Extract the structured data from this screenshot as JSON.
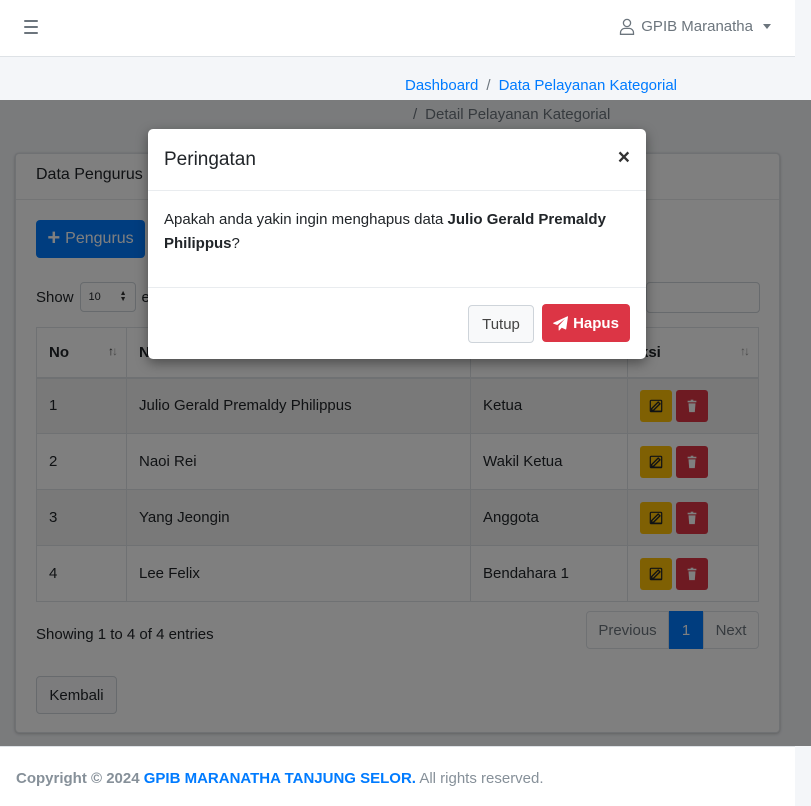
{
  "navbar": {
    "user_name": "GPIB Maranatha"
  },
  "breadcrumb": {
    "items": [
      "Dashboard",
      "Data Pelayanan Kategorial",
      "Detail Pelayanan Kategorial"
    ],
    "separator": "/"
  },
  "card": {
    "title": "Data Pengurus ",
    "add_button_label": "Pengurus",
    "show_label": "Show",
    "length_value": "10",
    "entries_label": "en",
    "columns": [
      "No",
      "N",
      "",
      "ksi"
    ],
    "rows": [
      {
        "no": "1",
        "name": "Julio Gerald Premaldy Philippus",
        "role": "Ketua"
      },
      {
        "no": "2",
        "name": "Naoi Rei",
        "role": "Wakil Ketua"
      },
      {
        "no": "3",
        "name": "Yang Jeongin",
        "role": "Anggota"
      },
      {
        "no": "4",
        "name": "Lee Felix",
        "role": "Bendahara 1"
      }
    ],
    "info": "Showing 1 to 4 of 4 entries",
    "pagination": {
      "previous": "Previous",
      "current": "1",
      "next": "Next"
    },
    "back_label": "Kembali"
  },
  "footer": {
    "prefix": "Copyright © 2024 ",
    "brand": "GPIB MARANATHA TANJUNG SELOR.",
    "suffix": " All rights reserved."
  },
  "modal": {
    "title": "Peringatan",
    "close": "×",
    "message_prefix": "Apakah anda yakin ingin menghapus data ",
    "message_target": "Julio Gerald Premaldy Philippus",
    "message_suffix": "?",
    "close_label": "Tutup",
    "delete_label": "Hapus"
  },
  "colors": {
    "primary": "#007bff",
    "danger": "#dc3545",
    "warning": "#ffc107"
  },
  "icons": [
    "menu-icon",
    "user-icon",
    "plus-icon",
    "edit-icon",
    "trash-icon",
    "send-icon",
    "sort-icon"
  ]
}
